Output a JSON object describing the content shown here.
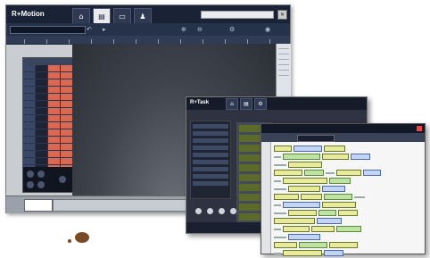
{
  "headline": "",
  "window_main": {
    "logo_prefix": "R+",
    "logo_text": "Motion",
    "tabs": [
      {
        "icon": "home-icon",
        "glyph": "⌂"
      },
      {
        "icon": "document-icon",
        "glyph": "▤"
      },
      {
        "icon": "monitor-icon",
        "glyph": "▭"
      },
      {
        "icon": "user-icon",
        "glyph": "♟"
      }
    ],
    "window_button": "✕",
    "toolbar_glyphs": [
      "↶",
      "▸",
      "⊕",
      "⊖",
      "⚙",
      "◉"
    ]
  },
  "window_task": {
    "logo_prefix": "R+",
    "logo_text": "Task",
    "tabs": [
      {
        "icon": "home-icon",
        "glyph": "⌂"
      },
      {
        "icon": "document-icon",
        "glyph": "▤"
      },
      {
        "icon": "gear-icon",
        "glyph": "⚙"
      }
    ],
    "icon_glyphs": [
      "●",
      "●",
      "●",
      "●"
    ]
  },
  "window_code": {
    "close_glyph": "✕"
  },
  "colors": {
    "headline": "#e31b23",
    "app_dark": "#1a2236",
    "panel_red": "#d86a55",
    "code_chip": "#e9eb9c"
  }
}
